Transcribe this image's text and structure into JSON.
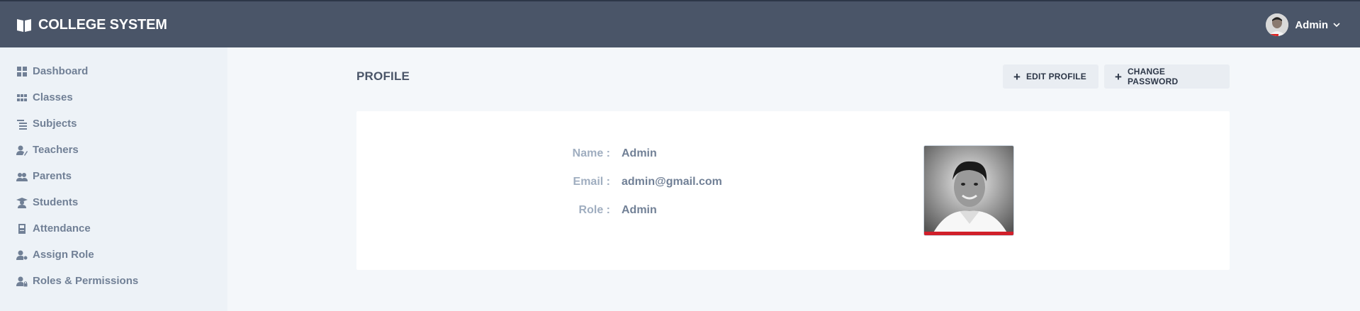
{
  "app": {
    "title": "COLLEGE SYSTEM"
  },
  "user": {
    "name": "Admin"
  },
  "sidebar": {
    "items": [
      {
        "label": "Dashboard",
        "icon": "grid-icon"
      },
      {
        "label": "Classes",
        "icon": "apps-icon"
      },
      {
        "label": "Subjects",
        "icon": "list-icon"
      },
      {
        "label": "Teachers",
        "icon": "user-edit-icon"
      },
      {
        "label": "Parents",
        "icon": "users-icon"
      },
      {
        "label": "Students",
        "icon": "graduate-icon"
      },
      {
        "label": "Attendance",
        "icon": "clipboard-icon"
      },
      {
        "label": "Assign Role",
        "icon": "user-key-icon"
      },
      {
        "label": "Roles & Permissions",
        "icon": "user-lock-icon"
      }
    ]
  },
  "main": {
    "title": "PROFILE",
    "edit_profile": "EDIT PROFILE",
    "change_password": "CHANGE PASSWORD",
    "profile": {
      "name_label": "Name :",
      "name": "Admin",
      "email_label": "Email :",
      "email": "admin@gmail.com",
      "role_label": "Role :",
      "role": "Admin"
    }
  }
}
